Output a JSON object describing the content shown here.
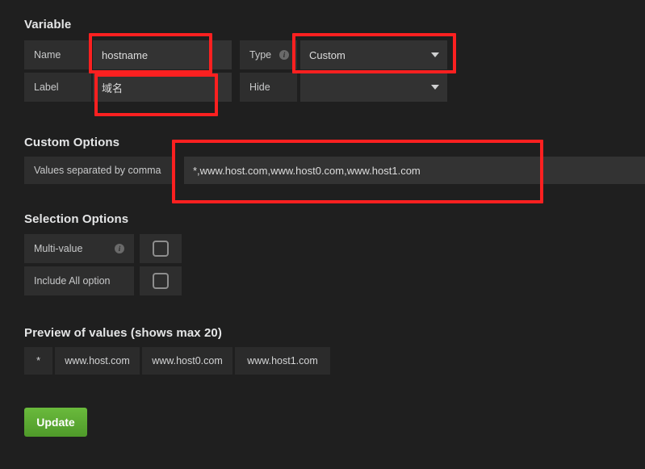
{
  "theme": {
    "page_bg": "#1f1f1f",
    "cell_bg": "#2e2e2e",
    "input_bg": "#333333",
    "text": "#d8d9da",
    "accent_button": "#5aa432",
    "annotation": "#fc2020"
  },
  "sections": {
    "variable": {
      "title": "Variable",
      "rows": [
        {
          "left_label": "Name",
          "left_value": "hostname",
          "right_label": "Type",
          "right_info_icon": "info-icon",
          "right_value": "Custom",
          "right_caret_icon": "chevron-down-icon"
        },
        {
          "left_label": "Label",
          "left_value": "域名",
          "right_label": "Hide",
          "right_value": "",
          "right_caret_icon": "chevron-down-icon"
        }
      ]
    },
    "custom_options": {
      "title": "Custom Options",
      "field_label": "Values separated by comma",
      "field_value": "*,www.host.com,www.host0.com,www.host1.com"
    },
    "selection_options": {
      "title": "Selection Options",
      "rows": [
        {
          "label": "Multi-value",
          "info_icon": "info-icon",
          "checked": false
        },
        {
          "label": "Include All option",
          "info_icon": null,
          "checked": false
        }
      ]
    },
    "preview": {
      "title": "Preview of values (shows max 20)",
      "values": [
        "*",
        "www.host.com",
        "www.host0.com",
        "www.host1.com"
      ]
    },
    "actions": {
      "update_label": "Update"
    }
  }
}
